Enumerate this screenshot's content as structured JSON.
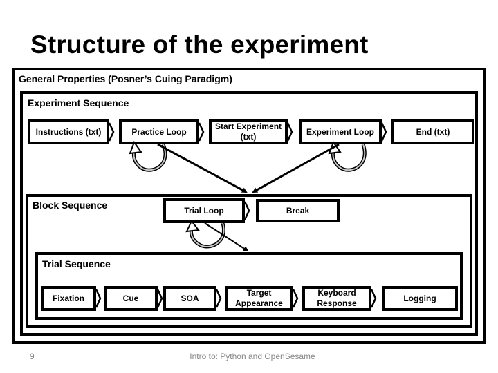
{
  "slide": {
    "title": "Structure of the experiment",
    "page_number": "9",
    "footer": "Intro to: Python and OpenSesame"
  },
  "frames": {
    "general": {
      "label": "General Properties (Posner’s Cuing Paradigm)"
    },
    "experiment_sequence": {
      "label": "Experiment Sequence"
    },
    "block_sequence": {
      "label": "Block Sequence"
    },
    "trial_sequence": {
      "label": "Trial Sequence"
    }
  },
  "experiment_sequence_items": [
    {
      "line1": "Instructions (txt)",
      "line2": ""
    },
    {
      "line1": "Practice Loop",
      "line2": ""
    },
    {
      "line1": "Start Experiment",
      "line2": "(txt)"
    },
    {
      "line1": "Experiment Loop",
      "line2": ""
    },
    {
      "line1": "End (txt)",
      "line2": ""
    }
  ],
  "block_sequence_items": [
    {
      "line1": "Trial Loop",
      "line2": ""
    },
    {
      "line1": "Break",
      "line2": ""
    }
  ],
  "trial_sequence_items": [
    {
      "line1": "Fixation",
      "line2": ""
    },
    {
      "line1": "Cue",
      "line2": ""
    },
    {
      "line1": "SOA",
      "line2": ""
    },
    {
      "line1": "Target",
      "line2": "Appearance"
    },
    {
      "line1": "Keyboard",
      "line2": "Response"
    },
    {
      "line1": "Logging",
      "line2": ""
    }
  ],
  "colors": {
    "line": "#000000",
    "loop_arrow_shade": "#c8c8c8",
    "footer_text": "#888888"
  }
}
